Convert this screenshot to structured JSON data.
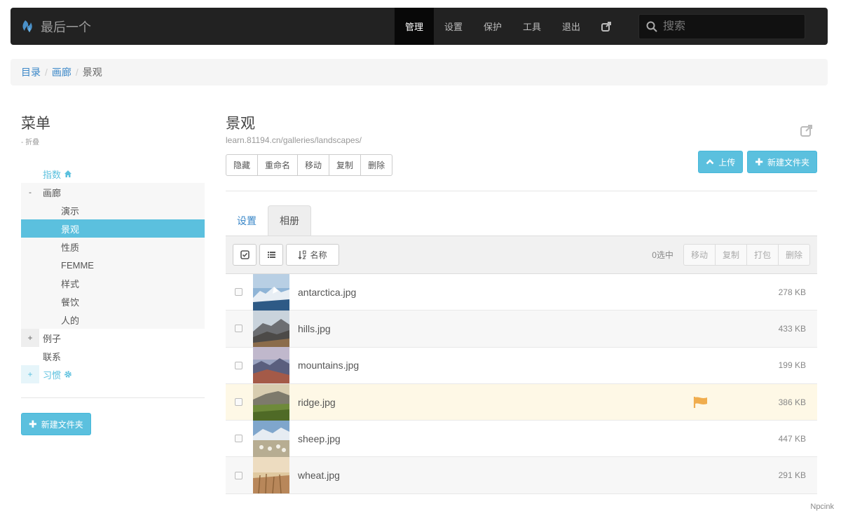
{
  "navbar": {
    "brand": "最后一个",
    "items": [
      {
        "label": "管理",
        "active": true
      },
      {
        "label": "设置"
      },
      {
        "label": "保护"
      },
      {
        "label": "工具"
      },
      {
        "label": "退出"
      }
    ],
    "external_icon": "external-link-icon",
    "search_placeholder": "搜索"
  },
  "breadcrumb": {
    "items": [
      "目录",
      "画廊"
    ],
    "current": "景观"
  },
  "sidebar": {
    "title": "菜单",
    "subtitle": "- 折叠",
    "tree": [
      {
        "label": "指数",
        "icon": "home-icon",
        "level": 0
      },
      {
        "label": "画廊",
        "toggle": "-",
        "level": 0
      },
      {
        "label": "演示",
        "level": 1
      },
      {
        "label": "景观",
        "level": 1,
        "selected": true
      },
      {
        "label": "性质",
        "level": 1
      },
      {
        "label": "FEMME",
        "level": 1
      },
      {
        "label": "样式",
        "level": 1
      },
      {
        "label": "餐饮",
        "level": 1
      },
      {
        "label": "人的",
        "level": 1
      },
      {
        "label": "例子",
        "toggle": "+",
        "level": 0
      },
      {
        "label": "联系",
        "level": 0
      },
      {
        "label": "习惯",
        "toggle": "+",
        "icon": "gear-icon",
        "level": 0
      }
    ],
    "new_folder": "新建文件夹"
  },
  "main": {
    "title": "景观",
    "url": "learn.81194.cn/galleries/landscapes/",
    "actions": [
      "隐藏",
      "重命名",
      "移动",
      "复制",
      "删除"
    ],
    "upload": "上传",
    "new_folder": "新建文件夹",
    "tabs": [
      {
        "label": "设置"
      },
      {
        "label": "相册",
        "active": true
      }
    ],
    "sort_label": "名称",
    "selected_count": "0选中",
    "bulk_actions": [
      "移动",
      "复制",
      "打包",
      "删除"
    ],
    "files": [
      {
        "name": "antarctica.jpg",
        "size": "278 KB"
      },
      {
        "name": "hills.jpg",
        "size": "433 KB"
      },
      {
        "name": "mountains.jpg",
        "size": "199 KB"
      },
      {
        "name": "ridge.jpg",
        "size": "386 KB",
        "flagged": true
      },
      {
        "name": "sheep.jpg",
        "size": "447 KB"
      },
      {
        "name": "wheat.jpg",
        "size": "291 KB"
      }
    ]
  },
  "watermark": "Npcink",
  "colors": {
    "accent": "#5bc0de",
    "link": "#3a87c8",
    "navbar": "#222222",
    "flag": "#f0ad4e"
  }
}
